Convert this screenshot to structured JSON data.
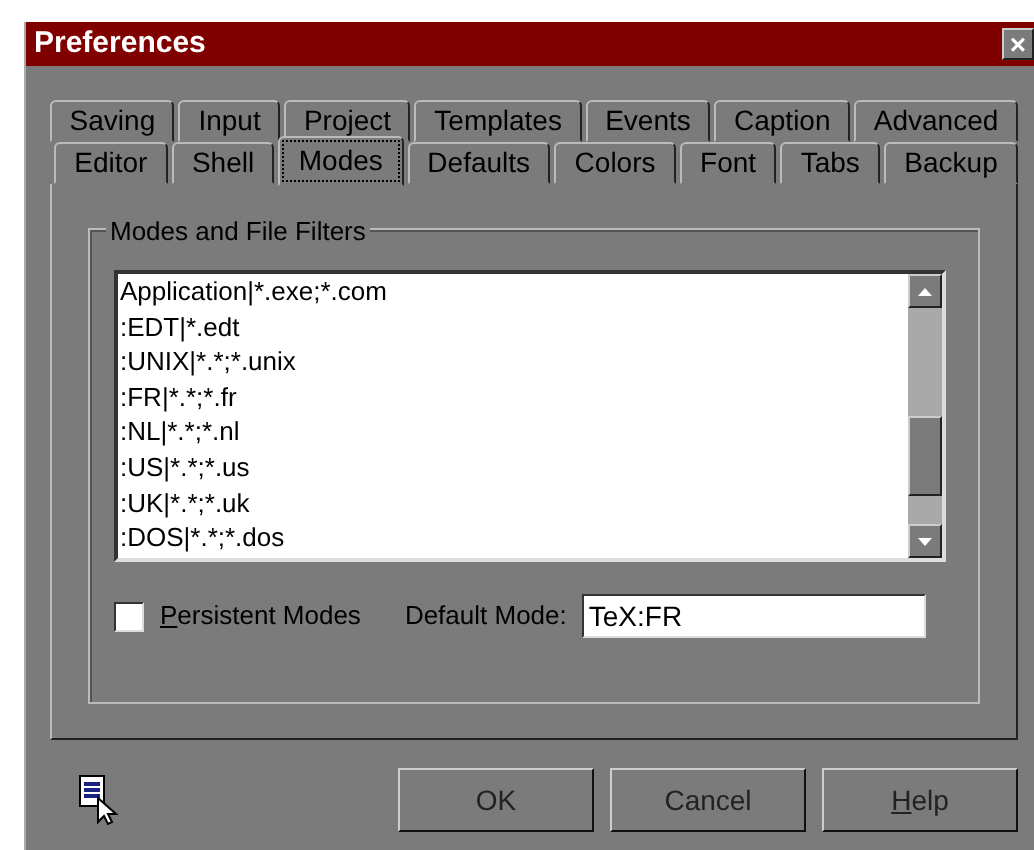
{
  "window": {
    "title": "Preferences",
    "close": "×"
  },
  "tab_rows": [
    {
      "tabs": [
        {
          "label": "Saving",
          "selected": false
        },
        {
          "label": "Input",
          "selected": false
        },
        {
          "label": "Project",
          "selected": false
        },
        {
          "label": "Templates",
          "selected": false
        },
        {
          "label": "Events",
          "selected": false
        },
        {
          "label": "Caption",
          "selected": false
        },
        {
          "label": "Advanced",
          "selected": false
        }
      ]
    },
    {
      "tabs": [
        {
          "label": "Editor",
          "selected": false
        },
        {
          "label": "Shell",
          "selected": false
        },
        {
          "label": "Modes",
          "selected": true
        },
        {
          "label": "Defaults",
          "selected": false
        },
        {
          "label": "Colors",
          "selected": false
        },
        {
          "label": "Font",
          "selected": false
        },
        {
          "label": "Tabs",
          "selected": false
        },
        {
          "label": "Backup",
          "selected": false
        }
      ]
    }
  ],
  "group": {
    "title": "Modes and File Filters",
    "list_items": [
      "Application|*.exe;*.com",
      ":EDT|*.edt",
      ":UNIX|*.*;*.unix",
      ":FR|*.*;*.fr",
      ":NL|*.*;*.nl",
      ":US|*.*;*.us",
      ":UK|*.*;*.uk",
      ":DOS|*.*;*.dos"
    ],
    "persistent_modes": {
      "label": "Persistent Modes",
      "checked": false,
      "underline_first": true
    },
    "default_mode": {
      "label": "Default Mode:",
      "value": "TeX:FR"
    }
  },
  "buttons": [
    {
      "label": "OK",
      "underline_first": false
    },
    {
      "label": "Cancel",
      "underline_first": false
    },
    {
      "label": "Help",
      "underline_first": true
    }
  ]
}
